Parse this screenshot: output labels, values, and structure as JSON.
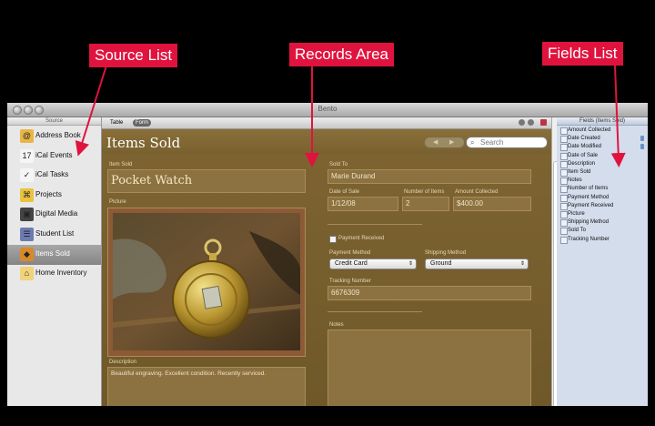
{
  "annotations": {
    "source_list": "Source List",
    "records_area": "Records Area",
    "fields_list": "Fields List"
  },
  "window": {
    "title": "Bento"
  },
  "source_list": {
    "header": "Source",
    "items": [
      {
        "label": "Address Book",
        "icon": "address-book-icon",
        "glyph": "@",
        "color": "#e8b646"
      },
      {
        "label": "iCal Events",
        "icon": "calendar-icon",
        "glyph": "17",
        "color": "#f5f5f5"
      },
      {
        "label": "iCal Tasks",
        "icon": "tasks-icon",
        "glyph": "✓",
        "color": "#f5f5f5"
      },
      {
        "label": "Projects",
        "icon": "projects-icon",
        "glyph": "⌘",
        "color": "#e9c23f"
      },
      {
        "label": "Digital Media",
        "icon": "media-icon",
        "glyph": "▣",
        "color": "#444444"
      },
      {
        "label": "Student List",
        "icon": "student-list-icon",
        "glyph": "☰",
        "color": "#6c7bb0"
      },
      {
        "label": "Items Sold",
        "icon": "items-sold-icon",
        "glyph": "◆",
        "color": "#d88a2a",
        "selected": true
      },
      {
        "label": "Home Inventory",
        "icon": "home-icon",
        "glyph": "⌂",
        "color": "#f0d37a"
      }
    ]
  },
  "toolbar": {
    "tab_table": "Table",
    "tab_form": "Form"
  },
  "records": {
    "title": "Items Sold",
    "search_placeholder": "Search",
    "item_sold_label": "Item Sold",
    "item_sold_value": "Pocket Watch",
    "picture_label": "Picture",
    "description_label": "Description",
    "description_value": "Beautiful engraving. Excellent condition. Recently serviced.",
    "sold_to_label": "Sold To",
    "sold_to_value": "Marie Durand",
    "date_of_sale_label": "Date of Sale",
    "date_of_sale_value": "1/12/08",
    "number_of_items_label": "Number of Items",
    "number_of_items_value": "2",
    "amount_collected_label": "Amount Collected",
    "amount_collected_value": "$400.00",
    "payment_received_label": "Payment Received",
    "payment_method_label": "Payment Method",
    "payment_method_value": "Credit Card",
    "shipping_method_label": "Shipping Method",
    "shipping_method_value": "Ground",
    "tracking_number_label": "Tracking Number",
    "tracking_number_value": "6676309",
    "notes_label": "Notes"
  },
  "fields_list": {
    "header": "Fields (Items Sold)",
    "items": [
      {
        "label": "Amount Collected"
      },
      {
        "label": "Date Created",
        "locked": true
      },
      {
        "label": "Date Modified",
        "locked": true
      },
      {
        "label": "Date of Sale"
      },
      {
        "label": "Description"
      },
      {
        "label": "Item Sold"
      },
      {
        "label": "Notes"
      },
      {
        "label": "Number of Items"
      },
      {
        "label": "Payment Method"
      },
      {
        "label": "Payment Received"
      },
      {
        "label": "Picture"
      },
      {
        "label": "Shipping Method"
      },
      {
        "label": "Sold To"
      },
      {
        "label": "Tracking Number"
      }
    ]
  }
}
